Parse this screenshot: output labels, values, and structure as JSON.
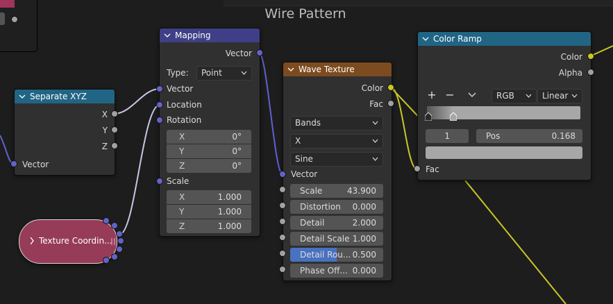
{
  "frame": {
    "title": "Wire Pattern"
  },
  "colors": {
    "background": "#1d1d1d",
    "node_body": "#303030",
    "header_mapping": "#3f3f87",
    "header_separate": "#216585",
    "header_wave": "#7d4b20",
    "header_colorramp": "#216585",
    "texcoord_body": "#963c58",
    "socket_vector": "#6363c7",
    "socket_float": "#a1a1a1",
    "socket_color": "#c7c729",
    "slider_fill": "#4872c0"
  },
  "separate_xyz": {
    "title": "Separate XYZ",
    "outputs": [
      "X",
      "Y",
      "Z"
    ],
    "input_label": "Vector"
  },
  "mapping": {
    "title": "Mapping",
    "output_label": "Vector",
    "type_label": "Type:",
    "type_value": "Point",
    "inputs": {
      "vector": "Vector",
      "location": "Location",
      "rotation": "Rotation",
      "scale": "Scale"
    },
    "rotation_rows": [
      {
        "axis": "X",
        "value": "0°"
      },
      {
        "axis": "Y",
        "value": "0°"
      },
      {
        "axis": "Z",
        "value": "0°"
      }
    ],
    "scale_rows": [
      {
        "axis": "X",
        "value": "1.000"
      },
      {
        "axis": "Y",
        "value": "1.000"
      },
      {
        "axis": "Z",
        "value": "1.000"
      }
    ]
  },
  "wave_texture": {
    "title": "Wave Texture",
    "outputs": {
      "color": "Color",
      "fac": "Fac"
    },
    "wave_type": "Bands",
    "direction": "X",
    "profile": "Sine",
    "vector_label": "Vector",
    "fields": [
      {
        "label": "Scale",
        "value": "43.900",
        "fill": 0
      },
      {
        "label": "Distortion",
        "value": "0.000",
        "fill": 0
      },
      {
        "label": "Detail",
        "value": "2.000",
        "fill": 0
      },
      {
        "label": "Detail Scale",
        "value": "1.000",
        "fill": 0
      },
      {
        "label": "Detail Rou...",
        "value": "0.500",
        "fill": 0.5
      },
      {
        "label": "Phase Off...",
        "value": "0.000",
        "fill": 0
      }
    ]
  },
  "color_ramp": {
    "title": "Color Ramp",
    "outputs": {
      "color": "Color",
      "alpha": "Alpha"
    },
    "add_label": "+",
    "remove_label": "−",
    "color_mode": "RGB",
    "interpolation": "Linear",
    "stop_index": "1",
    "pos_label": "Pos",
    "pos_value": "0.168",
    "input_label": "Fac"
  },
  "texture_coordinate": {
    "title": "Texture Coordin..."
  }
}
